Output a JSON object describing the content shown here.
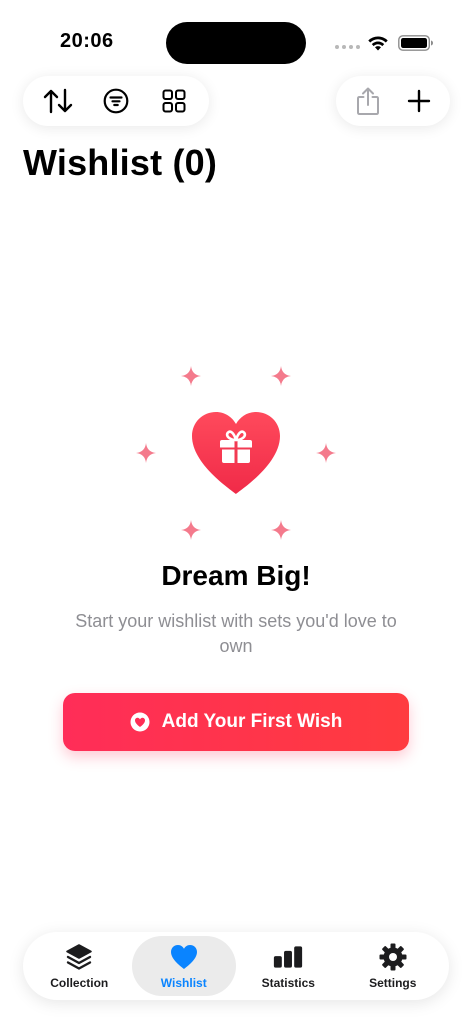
{
  "status_bar": {
    "time": "20:06"
  },
  "toolbar": {
    "left_icons": [
      "sort-arrows-icon",
      "filter-icon",
      "grid-view-icon"
    ],
    "right_icons": [
      "share-icon",
      "plus-icon"
    ]
  },
  "page": {
    "title": "Wishlist (0)"
  },
  "empty_state": {
    "title": "Dream Big!",
    "subtitle": "Start your wishlist with sets you'd love to own",
    "button_label": "Add Your First Wish",
    "graphic_icons": [
      "heart-gift-icon",
      "sparkle-icon"
    ]
  },
  "tab_bar": {
    "items": [
      {
        "label": "Collection",
        "icon": "stack-icon",
        "active": false
      },
      {
        "label": "Wishlist",
        "icon": "heart-icon",
        "active": true
      },
      {
        "label": "Statistics",
        "icon": "bar-chart-icon",
        "active": false
      },
      {
        "label": "Settings",
        "icon": "gear-icon",
        "active": false
      }
    ]
  },
  "colors": {
    "accent": "#0a84ff",
    "primary_red": "#ff2d55",
    "sparkle": "#f47a8c",
    "subtitle_gray": "#8e8e93",
    "tab_active_bg": "#ebebeb"
  }
}
